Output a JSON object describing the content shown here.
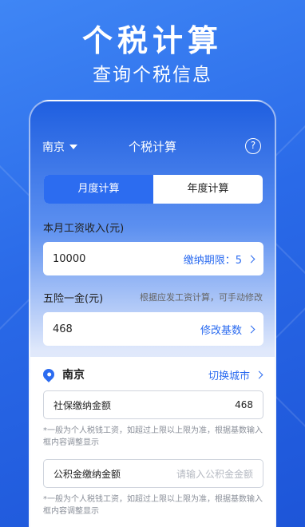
{
  "hero": {
    "title": "个税计算",
    "subtitle": "查询个税信息"
  },
  "topbar": {
    "city": "南京",
    "title": "个税计算",
    "help_symbol": "?"
  },
  "tabs": [
    {
      "label": "月度计算",
      "active": true
    },
    {
      "label": "年度计算",
      "active": false
    }
  ],
  "income": {
    "label": "本月工资收入(元)",
    "value": "10000",
    "period_action": "缴纳期限：5"
  },
  "insurance": {
    "label": "五险一金(元)",
    "hint": "根据应发工资计算，可手动修改",
    "value": "468",
    "action": "修改基数"
  },
  "location": {
    "city": "南京",
    "switch_label": "切换城市"
  },
  "social": {
    "label": "社保缴纳金额",
    "value": "468",
    "note": "*一般为个人税钱工资，如超过上限以上限为准，根据基数输入框内容调整显示"
  },
  "fund": {
    "label": "公积金缴纳金额",
    "placeholder": "请输入公积金金额",
    "note": "*一般为个人税钱工资，如超过上限以上限为准，根据基数输入框内容调整显示"
  },
  "colors": {
    "accent": "#2c6cf0",
    "background": "#2a6ae8"
  }
}
